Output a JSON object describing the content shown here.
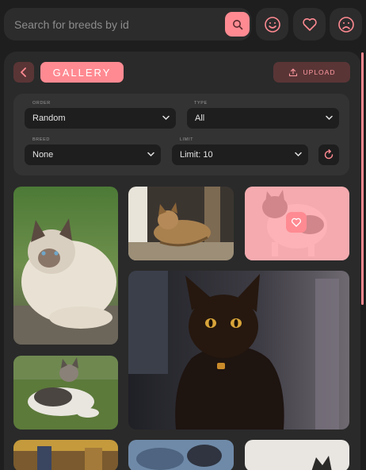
{
  "search": {
    "placeholder": "Search for breeds by id"
  },
  "top_icons": [
    "smile-icon",
    "heart-icon",
    "sad-icon"
  ],
  "header": {
    "title": "GALLERY",
    "upload_label": "UPLOAD"
  },
  "filters": {
    "order": {
      "label": "ORDER",
      "value": "Random"
    },
    "type": {
      "label": "TYPE",
      "value": "All"
    },
    "breed": {
      "label": "BREED",
      "value": "None"
    },
    "limit": {
      "label": "LIMIT",
      "value": "Limit: 10"
    }
  },
  "colors": {
    "accent": "#ff8a92",
    "accent_dark": "#5a3536",
    "background": "#1e1e1e",
    "panel": "#2a2a2a"
  }
}
